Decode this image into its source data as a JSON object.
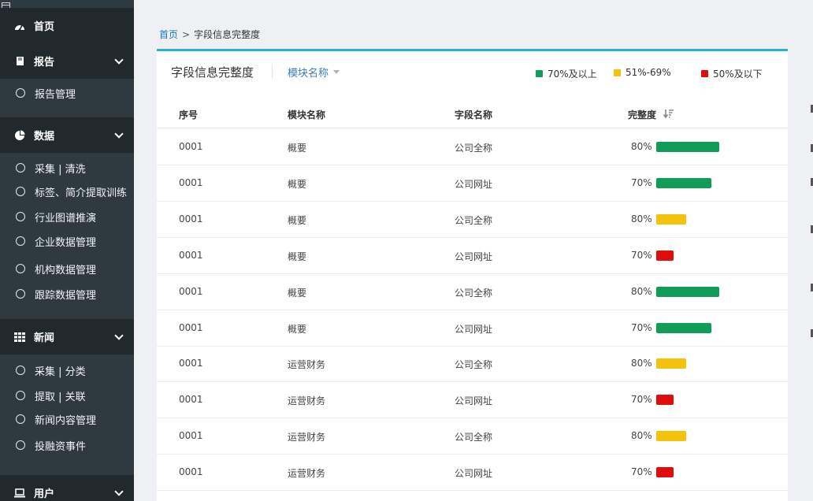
{
  "sidebar": {
    "home": {
      "label": "首页"
    },
    "sections": [
      {
        "label": "报告",
        "items": [
          "报告管理"
        ]
      },
      {
        "label": "数据",
        "items": [
          "采集 | 清洗",
          "标签、简介提取训练",
          "行业图谱推演",
          "企业数据管理",
          "机构数据管理",
          "跟踪数据管理"
        ]
      },
      {
        "label": "新闻",
        "items": [
          "采集 | 分类",
          "提取 | 关联",
          "新闻内容管理",
          "投融资事件"
        ]
      },
      {
        "label": "用户",
        "items": []
      }
    ]
  },
  "breadcrumb": {
    "home": "首页",
    "sep": ">",
    "current": "字段信息完整度"
  },
  "card": {
    "title": "字段信息完整度",
    "filter_label": "模块名称",
    "legend": [
      {
        "label": "70%及以上",
        "color": "#0f9d58"
      },
      {
        "label": "51%-69%",
        "color": "#f4c20d"
      },
      {
        "label": "50%及以下",
        "color": "#e00b0b"
      }
    ]
  },
  "table": {
    "headers": [
      "序号",
      "模块名称",
      "字段名称",
      "完整度"
    ],
    "rows": [
      {
        "id": "0001",
        "module": "概要",
        "field": "公司全称",
        "pct": "80%",
        "value": 80,
        "color": "#0f9d58"
      },
      {
        "id": "0001",
        "module": "概要",
        "field": "公司网址",
        "pct": "70%",
        "value": 70,
        "color": "#0f9d58"
      },
      {
        "id": "0001",
        "module": "概要",
        "field": "公司全称",
        "pct": "80%",
        "value": 80,
        "color": "#f4c20d"
      },
      {
        "id": "0001",
        "module": "概要",
        "field": "公司网址",
        "pct": "70%",
        "value": 70,
        "color": "#e00b0b"
      },
      {
        "id": "0001",
        "module": "概要",
        "field": "公司全称",
        "pct": "80%",
        "value": 80,
        "color": "#0f9d58"
      },
      {
        "id": "0001",
        "module": "概要",
        "field": "公司网址",
        "pct": "70%",
        "value": 70,
        "color": "#0f9d58"
      },
      {
        "id": "0001",
        "module": "运营财务",
        "field": "公司全称",
        "pct": "80%",
        "value": 80,
        "color": "#f4c20d"
      },
      {
        "id": "0001",
        "module": "运营财务",
        "field": "公司网址",
        "pct": "70%",
        "value": 70,
        "color": "#e00b0b"
      },
      {
        "id": "0001",
        "module": "运营财务",
        "field": "公司全称",
        "pct": "80%",
        "value": 80,
        "color": "#f4c20d"
      },
      {
        "id": "0001",
        "module": "运营财务",
        "field": "公司网址",
        "pct": "70%",
        "value": 70,
        "color": "#e00b0b"
      }
    ]
  }
}
